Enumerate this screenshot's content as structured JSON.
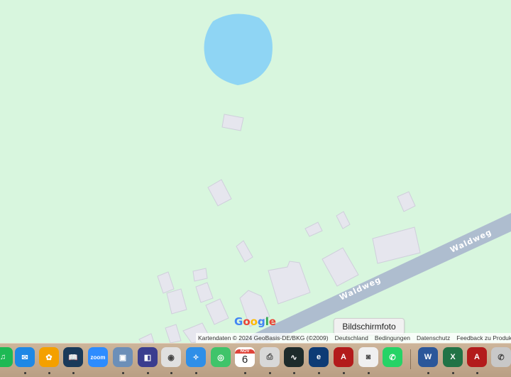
{
  "map": {
    "road_label_upper": "Waldweg",
    "road_label_lower": "Waldweg",
    "google_logo": "Google",
    "colors": {
      "land": "#d8f6de",
      "water": "#8fd5f4",
      "road": "#aebdcf",
      "building": "#e6e6ee"
    }
  },
  "attribution": {
    "map_data": "Kartendaten © 2024 GeoBasis-DE/BKG (©2009)",
    "country": "Deutschland",
    "terms": "Bedingungen",
    "privacy": "Datenschutz",
    "feedback": "Feedback zu Produkt(e"
  },
  "tooltip": {
    "label": "Bildschirmfoto"
  },
  "dock": {
    "items": [
      {
        "name": "spotify-icon",
        "glyph": "♫",
        "color": "#1db954"
      },
      {
        "name": "mail-icon",
        "glyph": "✉",
        "color": "#1e88e5"
      },
      {
        "name": "photos-icon",
        "glyph": "✿",
        "color": "#f4a000"
      },
      {
        "name": "kindle-icon",
        "glyph": "📖",
        "color": "#1a3a5a"
      },
      {
        "name": "zoom-icon",
        "glyph": "zoom",
        "color": "#2d8cff"
      },
      {
        "name": "preview-icon",
        "glyph": "▣",
        "color": "#6c8fb8"
      },
      {
        "name": "screenshot-app-icon",
        "glyph": "◧",
        "color": "#3a3d8f"
      },
      {
        "name": "chrome-icon",
        "glyph": "◉",
        "color": "#e0e0e0"
      },
      {
        "name": "safari-icon",
        "glyph": "✧",
        "color": "#2f8fe8"
      },
      {
        "name": "find-my-icon",
        "glyph": "◎",
        "color": "#3fc46a"
      },
      {
        "name": "calendar-icon",
        "glyph": "6",
        "color": "#ffffff",
        "month": "NOV"
      },
      {
        "name": "printer-icon",
        "glyph": "⎙",
        "color": "#d8d8d8"
      },
      {
        "name": "activity-monitor-icon",
        "glyph": "∿",
        "color": "#1d2b2b"
      },
      {
        "name": "app-e-icon",
        "glyph": "e",
        "color": "#0d3b75"
      },
      {
        "name": "acrobat-icon",
        "glyph": "A",
        "color": "#b31b1b"
      },
      {
        "name": "screenshot-icon",
        "glyph": "◙",
        "color": "#f0f0f0"
      },
      {
        "name": "whatsapp-icon",
        "glyph": "✆",
        "color": "#25d366"
      },
      {
        "name": "word-icon",
        "glyph": "W",
        "color": "#2b579a"
      },
      {
        "name": "excel-icon",
        "glyph": "X",
        "color": "#217346"
      },
      {
        "name": "acrobat-reader-icon",
        "glyph": "A",
        "color": "#b31b1b"
      },
      {
        "name": "whatsapp-2-icon",
        "glyph": "✆",
        "color": "#c8c8c8"
      }
    ]
  }
}
